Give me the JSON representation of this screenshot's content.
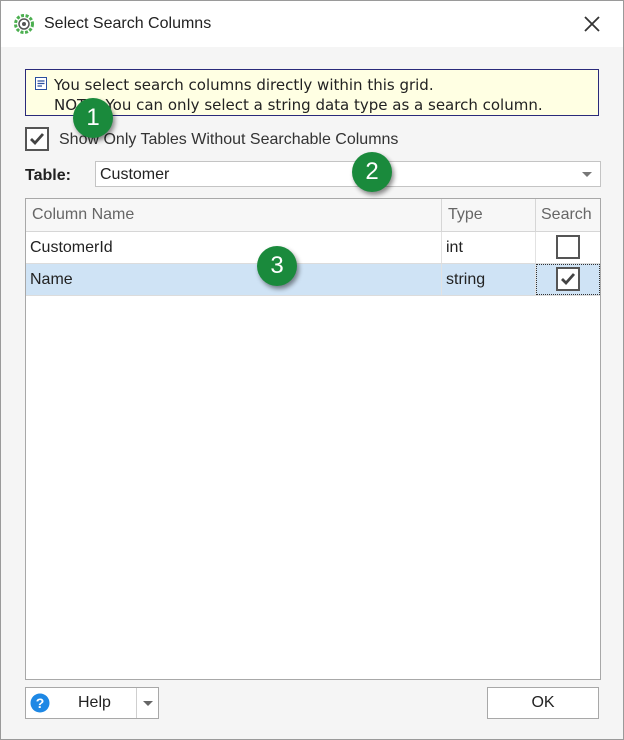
{
  "window": {
    "title": "Select Search Columns",
    "icon": "app-gear-icon",
    "close_icon": "close-icon"
  },
  "info": {
    "icon": "note-icon",
    "line1": "You select search columns directly within this grid.",
    "line2": "NOTE: You can only select a string data type as a search column."
  },
  "filter": {
    "label": "Show Only Tables Without Searchable Columns",
    "checked": true
  },
  "table_select": {
    "label": "Table:",
    "value": "Customer"
  },
  "grid": {
    "headers": [
      "Column Name",
      "Type",
      "Search"
    ],
    "rows": [
      {
        "name": "CustomerId",
        "type": "int",
        "search": false,
        "selected": false
      },
      {
        "name": "Name",
        "type": "string",
        "search": true,
        "selected": true
      }
    ]
  },
  "badges": [
    "1",
    "2",
    "3"
  ],
  "buttons": {
    "help_label": "Help",
    "help_icon": "question-icon",
    "ok_label": "OK"
  },
  "colors": {
    "badge": "#1a8a3c",
    "selected_row": "#cfe3f5",
    "info_bg": "#ffffe3",
    "help_icon": "#1e88e5"
  }
}
